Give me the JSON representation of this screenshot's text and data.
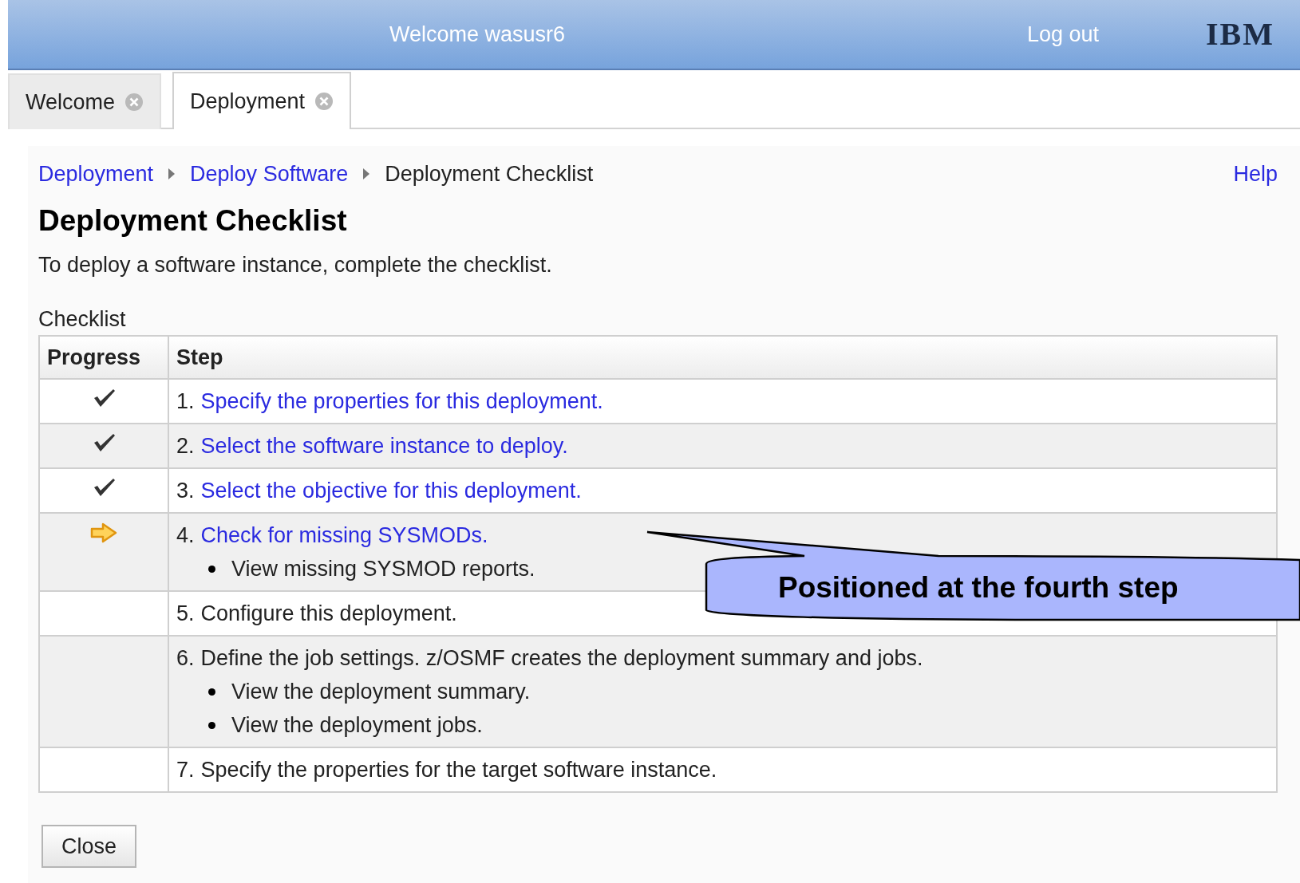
{
  "header": {
    "welcome": "Welcome wasusr6",
    "logout": "Log out",
    "logo": "IBM"
  },
  "tabs": [
    {
      "label": "Welcome",
      "selected": false
    },
    {
      "label": "Deployment",
      "selected": true
    }
  ],
  "breadcrumb": [
    {
      "label": "Deployment",
      "kind": "link"
    },
    {
      "label": "Deploy Software",
      "kind": "link"
    },
    {
      "label": "Deployment Checklist",
      "kind": "current"
    }
  ],
  "help": "Help",
  "title": "Deployment Checklist",
  "description": "To deploy a software instance, complete the checklist.",
  "table": {
    "caption": "Checklist",
    "columns": [
      "Progress",
      "Step"
    ],
    "rows": [
      {
        "kind": "done",
        "number": "1.",
        "text": "Specify the properties for this deployment.",
        "linked": true,
        "children": []
      },
      {
        "kind": "done",
        "number": "2.",
        "text": "Select the software instance to deploy.",
        "linked": true,
        "children": []
      },
      {
        "kind": "done",
        "number": "3.",
        "text": "Select the objective for this deployment.",
        "linked": true,
        "children": []
      },
      {
        "kind": "current",
        "number": "4.",
        "text": "Check for missing SYSMODs.",
        "linked": true,
        "children": [
          "View missing SYSMOD reports."
        ]
      },
      {
        "kind": "pending",
        "number": "5.",
        "text": "Configure this deployment.",
        "linked": false,
        "children": []
      },
      {
        "kind": "pending",
        "number": "6.",
        "text": "Define the job settings. z/OSMF creates the deployment summary and jobs.",
        "linked": false,
        "children": [
          "View the deployment summary.",
          "View the deployment jobs."
        ]
      },
      {
        "kind": "pending",
        "number": "7.",
        "text": "Specify the properties for the target software instance.",
        "linked": false,
        "children": []
      }
    ]
  },
  "close_button": "Close",
  "callout": "Positioned at the fourth step"
}
